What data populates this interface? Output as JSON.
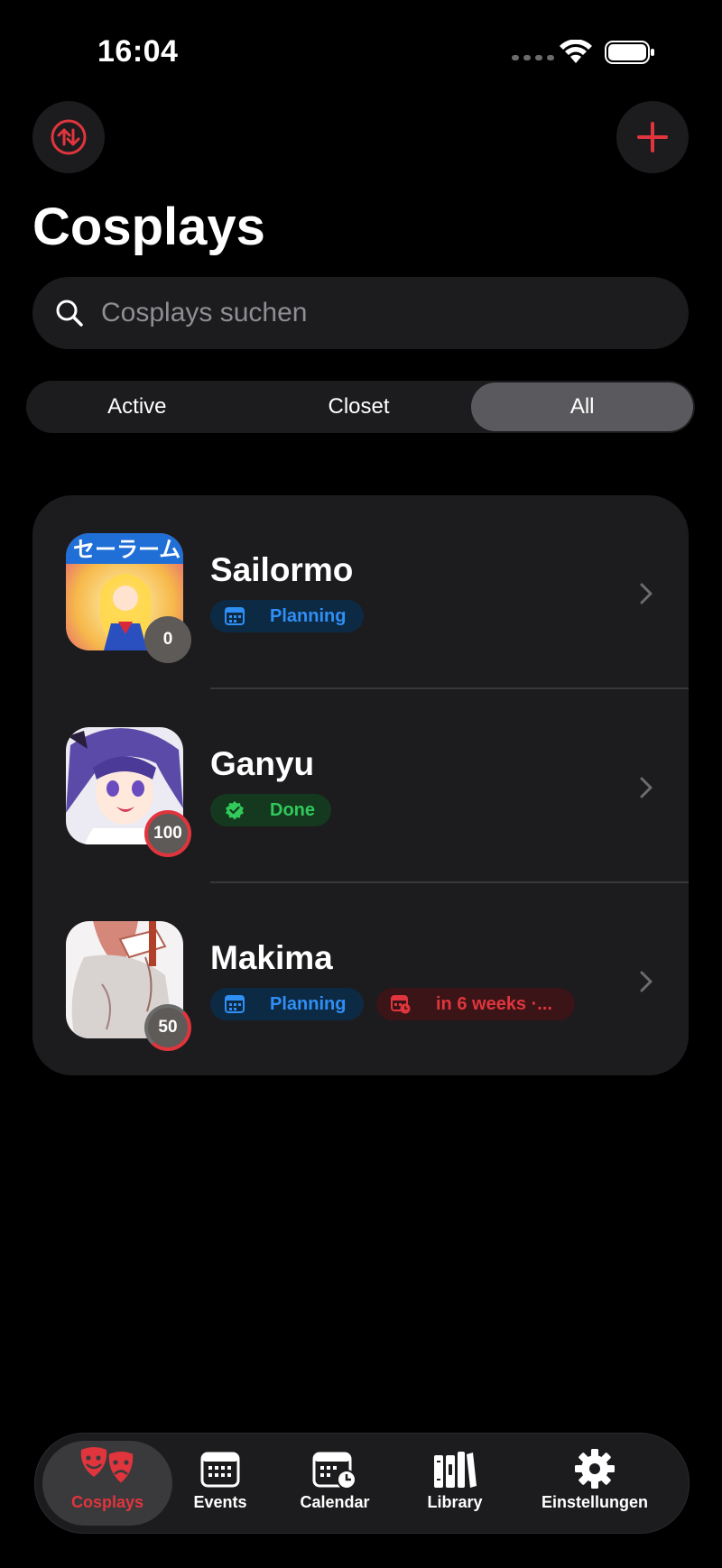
{
  "status": {
    "time": "16:04"
  },
  "header": {
    "title": "Cosplays"
  },
  "search": {
    "placeholder": "Cosplays suchen"
  },
  "segments": [
    {
      "label": "Active",
      "selected": false
    },
    {
      "label": "Closet",
      "selected": false
    },
    {
      "label": "All",
      "selected": true
    }
  ],
  "cosplays": [
    {
      "name": "Sailormo",
      "progress": "0",
      "progress_value": 0,
      "tags": [
        {
          "label": "Planning",
          "style": "blue",
          "icon": "calendar-icon"
        }
      ]
    },
    {
      "name": "Ganyu",
      "progress": "100",
      "progress_value": 100,
      "tags": [
        {
          "label": "Done",
          "style": "green",
          "icon": "checkmark-seal-icon"
        }
      ]
    },
    {
      "name": "Makima",
      "progress": "50",
      "progress_value": 50,
      "tags": [
        {
          "label": "Planning",
          "style": "blue",
          "icon": "calendar-icon"
        },
        {
          "label": "in 6 weeks ·...",
          "style": "red",
          "icon": "calendar-clock-icon"
        }
      ]
    }
  ],
  "tabbar": [
    {
      "label": "Cosplays",
      "icon": "theater-masks-icon",
      "active": true
    },
    {
      "label": "Events",
      "icon": "calendar-icon",
      "active": false
    },
    {
      "label": "Calendar",
      "icon": "calendar-clock-icon",
      "active": false
    },
    {
      "label": "Library",
      "icon": "books-icon",
      "active": false
    },
    {
      "label": "Einstellungen",
      "icon": "gear-icon",
      "active": false
    }
  ],
  "colors": {
    "accent": "#e0353d",
    "blue": "#2f8ff5",
    "green": "#30c95a",
    "card": "#1c1c1e"
  }
}
